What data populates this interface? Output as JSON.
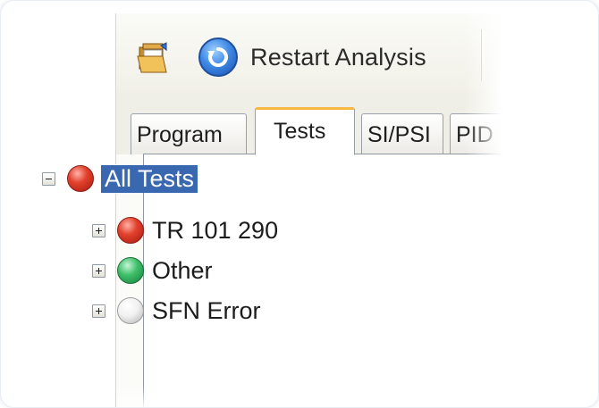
{
  "toolbar": {
    "open_icon": "folder-open-icon",
    "restart_icon": "restart-icon",
    "restart_label": "Restart Analysis"
  },
  "tabs": [
    {
      "label": "Program",
      "active": false
    },
    {
      "label": "Tests",
      "active": true
    },
    {
      "label": "SI/PSI",
      "active": false
    },
    {
      "label": "PID",
      "active": false
    }
  ],
  "tree": {
    "root": {
      "label": "All Tests",
      "status": "red",
      "expanded": true,
      "selected": true
    },
    "children": [
      {
        "label": "TR 101 290",
        "status": "red",
        "expanded": false
      },
      {
        "label": "Other",
        "status": "green",
        "expanded": false
      },
      {
        "label": "SFN Error",
        "status": "white",
        "expanded": false
      }
    ]
  },
  "colors": {
    "selection": "#3a68b0",
    "active_tab_accent": "#f7b743",
    "status_red": "#d63a28",
    "status_green": "#2fae5c",
    "status_white": "#f0f0f0"
  }
}
